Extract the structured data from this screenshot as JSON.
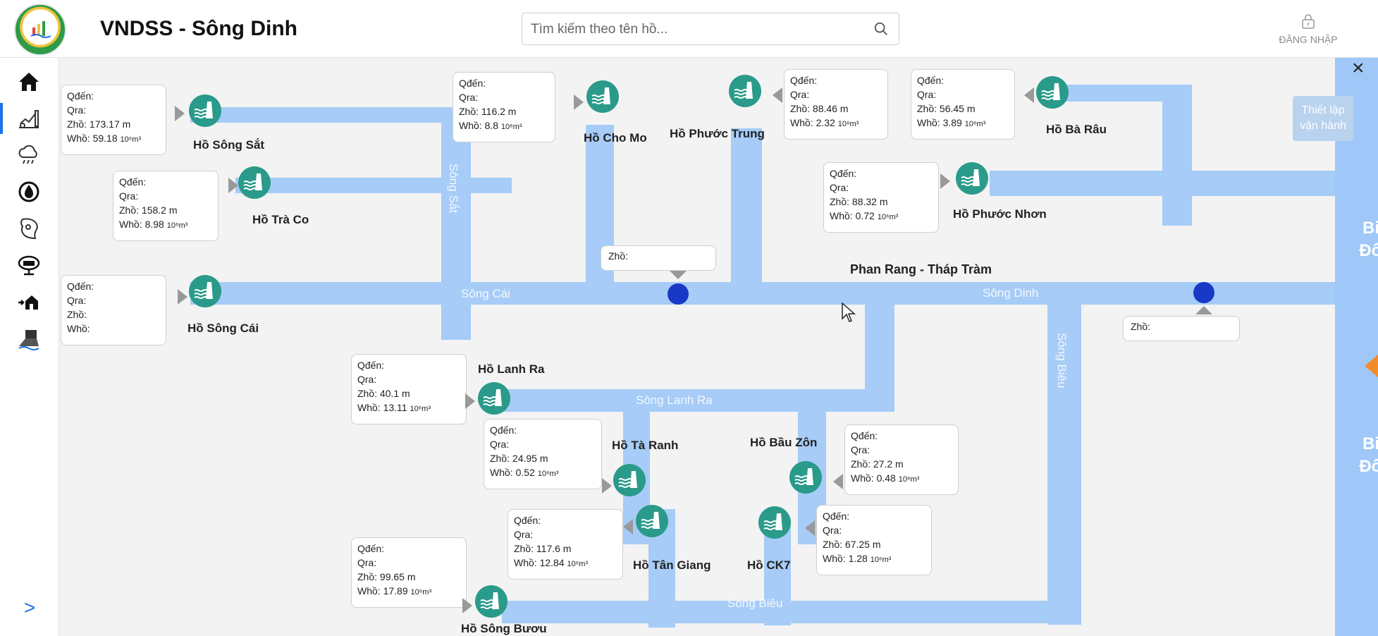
{
  "header": {
    "title": "VNDSS - Sông Dinh",
    "search_placeholder": "Tìm kiếm theo tên hồ...",
    "login_label": "ĐĂNG NHẬP"
  },
  "sidebar": {
    "items": [
      {
        "icon": "home-icon",
        "active": false
      },
      {
        "icon": "water-level-chart-icon",
        "active": true
      },
      {
        "icon": "weather-rain-icon",
        "active": false
      },
      {
        "icon": "water-drop-icon",
        "active": false
      },
      {
        "icon": "map-icon",
        "active": false
      },
      {
        "icon": "monitor-station-icon",
        "active": false
      },
      {
        "icon": "flood-house-icon",
        "active": false
      },
      {
        "icon": "landslide-icon",
        "active": false
      }
    ],
    "expand_label": ">"
  },
  "map": {
    "rivers": {
      "song_sat": "Sông Sắt",
      "song_cai": "Sông Cái",
      "song_dinh": "Sông Dinh",
      "song_lanh_ra": "Sông Lanh Ra",
      "song_bieu_h": "Sông Biêu",
      "song_bieu_v": "Sông Biêu"
    },
    "city": "Phan Rang - Tháp Tràm",
    "sea_top": [
      "Biển",
      "Đông"
    ],
    "sea_bottom": [
      "Biển",
      "Đông"
    ],
    "setup_button": [
      "Thiết lập",
      "vận hành"
    ],
    "close": "×",
    "field_labels": {
      "qden": "Qđến:",
      "qra": "Qra:",
      "zho": "Zhồ:",
      "who": "Whồ:"
    },
    "stations": [
      {
        "zho": "Zhồ:"
      },
      {
        "zho": "Zhồ:"
      }
    ],
    "reservoirs": [
      {
        "name": "Hồ Sông Sắt",
        "zho": "173.17 m",
        "who": "59.18"
      },
      {
        "name": "Hồ Trà Co",
        "zho": "158.2 m",
        "who": "8.98"
      },
      {
        "name": "Hồ Sông Cái",
        "zho": "",
        "who": ""
      },
      {
        "name": "Hồ Cho Mo",
        "zho": "116.2 m",
        "who": "8.8"
      },
      {
        "name": "Hồ Phước Trung",
        "zho": "88.46 m",
        "who": "2.32"
      },
      {
        "name": "Hồ Bà Râu",
        "zho": "56.45 m",
        "who": "3.89"
      },
      {
        "name": "Hồ Phước Nhơn",
        "zho": "88.32 m",
        "who": "0.72"
      },
      {
        "name": "Hồ Lanh Ra",
        "zho": "40.1 m",
        "who": "13.11"
      },
      {
        "name": "Hồ Tà Ranh",
        "zho": "24.95 m",
        "who": "0.52"
      },
      {
        "name": "Hồ Bầu Zôn",
        "zho": "27.2 m",
        "who": "0.48"
      },
      {
        "name": "Hồ Tân Giang",
        "zho": "117.6 m",
        "who": "12.84"
      },
      {
        "name": "Hồ CK7",
        "zho": "67.25 m",
        "who": "1.28"
      },
      {
        "name": "Hồ Sông Bươu",
        "zho": "99.65 m",
        "who": "17.89"
      }
    ],
    "volume_unit": "10⁶m³"
  },
  "colors": {
    "river": "#a6ccf7",
    "sea": "#9fc8f8",
    "dam": "#2a9a8a",
    "station": "#1839c5",
    "accent": "#1a73e8",
    "toggle": "#f28c28"
  }
}
